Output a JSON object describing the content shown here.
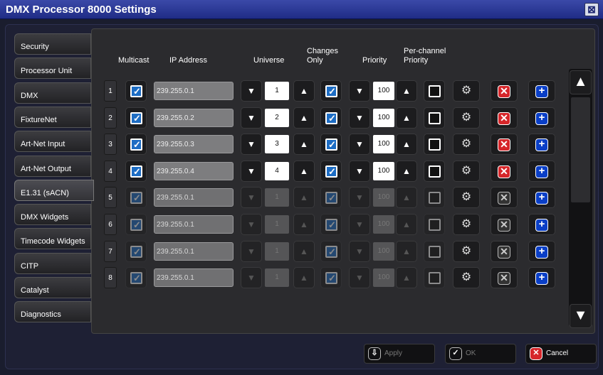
{
  "window": {
    "title": "DMX Processor 8000 Settings",
    "close_glyph": "⊠"
  },
  "sidebar": {
    "items": [
      {
        "label": "Security"
      },
      {
        "label": "Processor Unit"
      },
      {
        "label": "DMX"
      },
      {
        "label": "FixtureNet"
      },
      {
        "label": "Art-Net Input"
      },
      {
        "label": "Art-Net Output"
      },
      {
        "label": "E1.31 (sACN)",
        "active": true
      },
      {
        "label": "DMX Widgets"
      },
      {
        "label": "Timecode Widgets"
      },
      {
        "label": "CITP"
      },
      {
        "label": "Catalyst"
      },
      {
        "label": "Diagnostics"
      }
    ]
  },
  "table": {
    "headers": {
      "multicast": "Multicast",
      "ip": "IP Address",
      "universe": "Universe",
      "changes_only": "Changes Only",
      "priority": "Priority",
      "per_channel_priority": "Per-channel Priority"
    },
    "rows": [
      {
        "num": "1",
        "multicast": true,
        "ip": "239.255.0.1",
        "universe": "1",
        "changes_only": true,
        "priority": "100",
        "per_channel": false,
        "enabled": true
      },
      {
        "num": "2",
        "multicast": true,
        "ip": "239.255.0.2",
        "universe": "2",
        "changes_only": true,
        "priority": "100",
        "per_channel": false,
        "enabled": true
      },
      {
        "num": "3",
        "multicast": true,
        "ip": "239.255.0.3",
        "universe": "3",
        "changes_only": true,
        "priority": "100",
        "per_channel": false,
        "enabled": true
      },
      {
        "num": "4",
        "multicast": true,
        "ip": "239.255.0.4",
        "universe": "4",
        "changes_only": true,
        "priority": "100",
        "per_channel": false,
        "enabled": true
      },
      {
        "num": "5",
        "multicast": true,
        "ip": "239.255.0.1",
        "universe": "1",
        "changes_only": true,
        "priority": "100",
        "per_channel": false,
        "enabled": false
      },
      {
        "num": "6",
        "multicast": true,
        "ip": "239.255.0.1",
        "universe": "1",
        "changes_only": true,
        "priority": "100",
        "per_channel": false,
        "enabled": false
      },
      {
        "num": "7",
        "multicast": true,
        "ip": "239.255.0.1",
        "universe": "1",
        "changes_only": true,
        "priority": "100",
        "per_channel": false,
        "enabled": false
      },
      {
        "num": "8",
        "multicast": true,
        "ip": "239.255.0.1",
        "universe": "1",
        "changes_only": true,
        "priority": "100",
        "per_channel": false,
        "enabled": false
      }
    ]
  },
  "footer": {
    "apply_label": "Apply",
    "ok_label": "OK",
    "cancel_label": "Cancel"
  },
  "colors": {
    "accent": "#1d6dc4",
    "delete": "#d6262a",
    "add": "#0a3fc7",
    "title_bar": "#2a3796"
  }
}
